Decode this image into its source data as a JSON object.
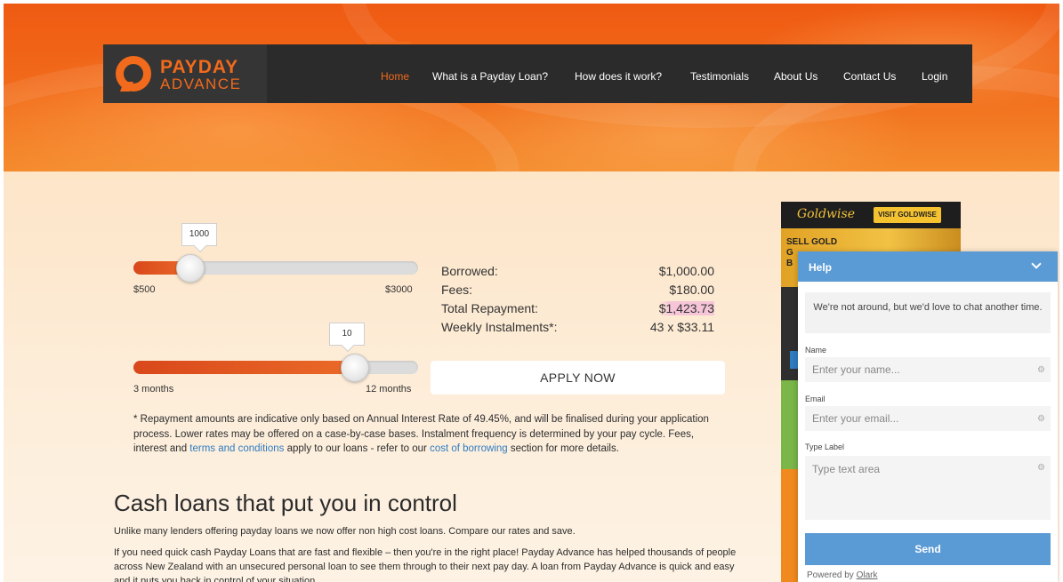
{
  "nav": {
    "logo_line1": "PAYDAY",
    "logo_line2": "ADVANCE",
    "items": [
      {
        "label": "Home",
        "active": true
      },
      {
        "label": "What is a Payday Loan?"
      },
      {
        "label": "How does it work?"
      },
      {
        "label": "Testimonials"
      },
      {
        "label": "About Us"
      },
      {
        "label": "Contact Us"
      },
      {
        "label": "Login"
      }
    ]
  },
  "calculator": {
    "amount_slider": {
      "value": "1000",
      "min_label": "$500",
      "max_label": "$3000",
      "fill_fraction": 0.2
    },
    "term_slider": {
      "value": "10",
      "min_label": "3 months",
      "max_label": "12 months",
      "fill_fraction": 0.778
    },
    "summary": [
      {
        "label": "Borrowed:",
        "value": "$1,000.00"
      },
      {
        "label": "Fees:",
        "value": "$180.00"
      },
      {
        "label": "Total Repayment:",
        "value": "$1,423.73"
      },
      {
        "label": "Weekly Instalments*:",
        "value": "43 x $33.11"
      }
    ],
    "apply_label": "APPLY NOW"
  },
  "disclaimer": {
    "text_before": "* Repayment amounts are indicative only based on Annual Interest Rate of 49.45%, and will be finalised during your application process. Lower rates may be offered on a case-by-case bases. Instalment frequency is determined by your pay cycle. Fees, interest and ",
    "link1": "terms and conditions",
    "text_middle": " apply to our loans - refer to our ",
    "link2": "cost of borrowing",
    "text_after": " section for more details."
  },
  "main": {
    "heading": "Cash loans that put you in control",
    "para1": "Unlike many lenders offering payday loans we now offer non high cost loans. Compare our rates and save.",
    "para2": "If you need quick cash Payday Loans that are fast and flexible – then you're in the right place! Payday Advance has helped thousands of people across New Zealand with an unsecured personal loan to see them through to their next pay day. A loan from Payday Advance is quick and easy and it puts you back in control of your situation."
  },
  "sidebar_ad": {
    "brand": "Goldwise",
    "visit_label": "VISIT GOLDWISE",
    "gold_text_1": "SELL GOLD",
    "gold_text_2": "G",
    "gold_text_3": "B"
  },
  "chat": {
    "title": "Help",
    "notice": "We're not around, but we'd love to chat another time.",
    "name_label": "Name",
    "name_placeholder": "Enter your name...",
    "email_label": "Email",
    "email_placeholder": "Enter your email...",
    "type_label": "Type Label",
    "textarea_placeholder": "Type text area",
    "send_label": "Send",
    "powered_prefix": "Powered by ",
    "powered_brand": "Olark"
  },
  "colors": {
    "brand_orange": "#f26a1b",
    "nav_bg": "#2b2b2b",
    "chat_blue": "#5b9bd5",
    "link_blue": "#2f7cc0"
  }
}
